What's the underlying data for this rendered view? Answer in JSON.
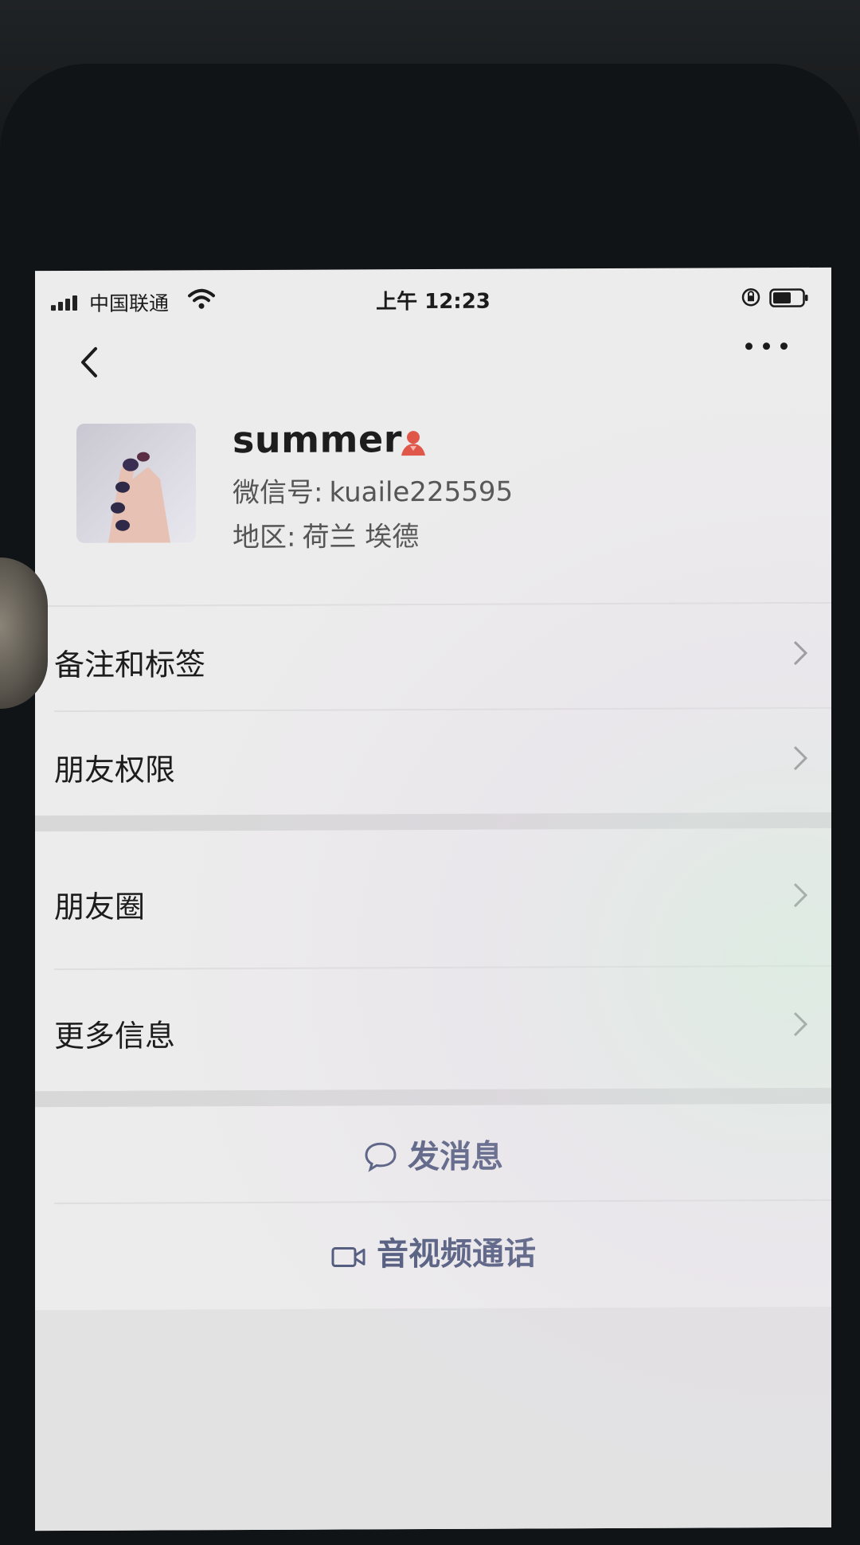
{
  "status_bar": {
    "carrier": "中国联通",
    "time": "上午 12:23"
  },
  "profile": {
    "nickname": "summer",
    "wechat_id_label": "微信号:",
    "wechat_id": "kuaile225595",
    "region_label": "地区:",
    "region": "荷兰 埃德",
    "gender_icon": "female-icon",
    "gender_color": "#e0574a"
  },
  "menu": {
    "remarks_tags": "备注和标签",
    "friend_permissions": "朋友权限",
    "moments": "朋友圈",
    "more_info": "更多信息"
  },
  "actions": {
    "send_message": "发消息",
    "video_call": "音视频通话",
    "accent_color": "#4a5578"
  }
}
